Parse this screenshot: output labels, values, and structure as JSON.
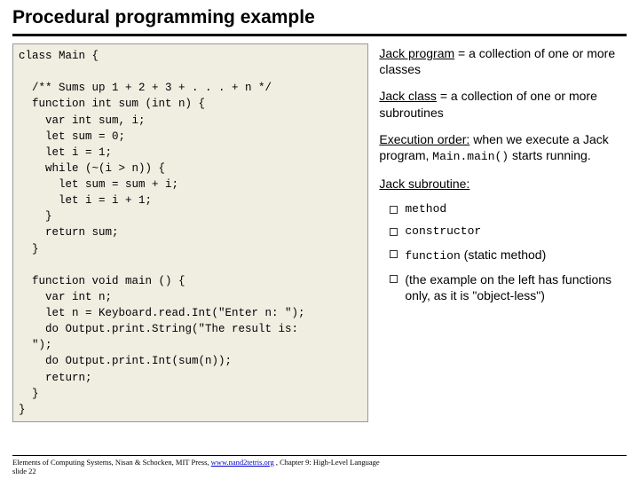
{
  "title": "Procedural programming example",
  "code": "class Main {\n\n  /** Sums up 1 + 2 + 3 + . . . + n */\n  function int sum (int n) {\n    var int sum, i;\n    let sum = 0;\n    let i = 1;\n    while (~(i > n)) {\n      let sum = sum + i;\n      let i = i + 1;\n    }\n    return sum;\n  }\n\n  function void main () {\n    var int n;\n    let n = Keyboard.read.Int(\"Enter n: \");\n    do Output.print.String(\"The result is: \n  \");\n    do Output.print.Int(sum(n));\n    return;\n  }\n}",
  "right": {
    "p1_a": "Jack program",
    "p1_b": " = a collection of one or more classes",
    "p2_a": "Jack class",
    "p2_b": " = a collection of one or more subroutines",
    "p3_a": "Execution order:",
    "p3_b": " when we execute a Jack program, ",
    "p3_c": "Main.main()",
    "p3_d": " starts running.",
    "p4": "Jack subroutine:",
    "bullets": {
      "b1": "method",
      "b2": "constructor",
      "b3_a": "function",
      "b3_b": " (static method)",
      "b4": "(the example on the left has functions only, as it is \"object-less\")"
    }
  },
  "footer": {
    "text1": "Elements of Computing Systems, Nisan & Schocken, MIT Press, ",
    "link": "www.nand2tetris.org",
    "text2": " , Chapter 9: High-Level Language",
    "slide": "slide 22"
  }
}
